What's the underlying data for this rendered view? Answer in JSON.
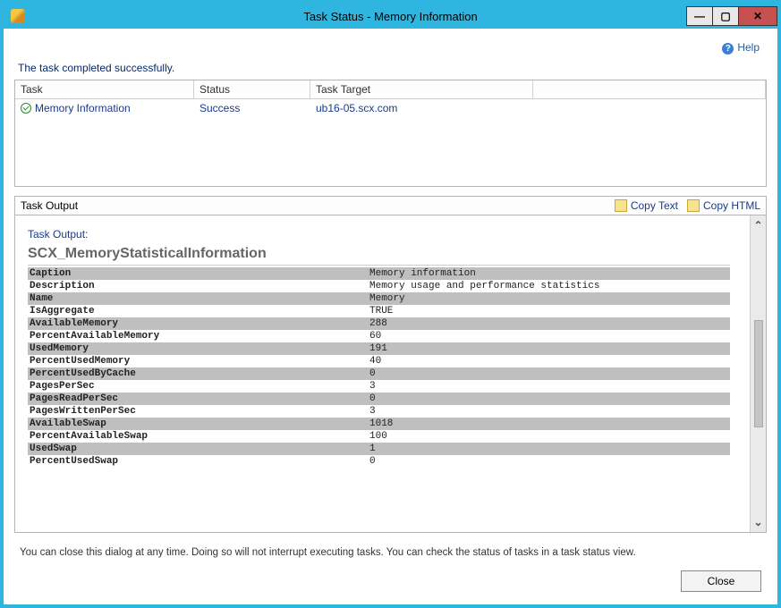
{
  "window": {
    "title": "Task Status - Memory Information"
  },
  "help": {
    "label": "Help"
  },
  "status_message": "The task completed successfully.",
  "task_table": {
    "headers": {
      "task": "Task",
      "status": "Status",
      "target": "Task Target"
    },
    "row": {
      "task": "Memory Information",
      "status": "Success",
      "target": "ub16-05.scx.com"
    }
  },
  "output_header": {
    "label": "Task Output",
    "copy_text": "Copy Text",
    "copy_html": "Copy HTML"
  },
  "output": {
    "section_label": "Task Output:",
    "scx_title": "SCX_MemoryStatisticalInformation",
    "rows": [
      {
        "k": "Caption",
        "v": "Memory information"
      },
      {
        "k": "Description",
        "v": "Memory usage and performance statistics"
      },
      {
        "k": "Name",
        "v": "Memory"
      },
      {
        "k": "IsAggregate",
        "v": "TRUE"
      },
      {
        "k": "AvailableMemory",
        "v": "288"
      },
      {
        "k": "PercentAvailableMemory",
        "v": "60"
      },
      {
        "k": "UsedMemory",
        "v": "191"
      },
      {
        "k": "PercentUsedMemory",
        "v": "40"
      },
      {
        "k": "PercentUsedByCache",
        "v": "0"
      },
      {
        "k": "PagesPerSec",
        "v": "3"
      },
      {
        "k": "PagesReadPerSec",
        "v": "0"
      },
      {
        "k": "PagesWrittenPerSec",
        "v": "3"
      },
      {
        "k": "AvailableSwap",
        "v": "1018"
      },
      {
        "k": "PercentAvailableSwap",
        "v": "100"
      },
      {
        "k": "UsedSwap",
        "v": "1"
      },
      {
        "k": "PercentUsedSwap",
        "v": "0"
      }
    ]
  },
  "footer_note": "You can close this dialog at any time. Doing so will not interrupt executing tasks. You can check the status of tasks in a task status view.",
  "buttons": {
    "close": "Close"
  }
}
